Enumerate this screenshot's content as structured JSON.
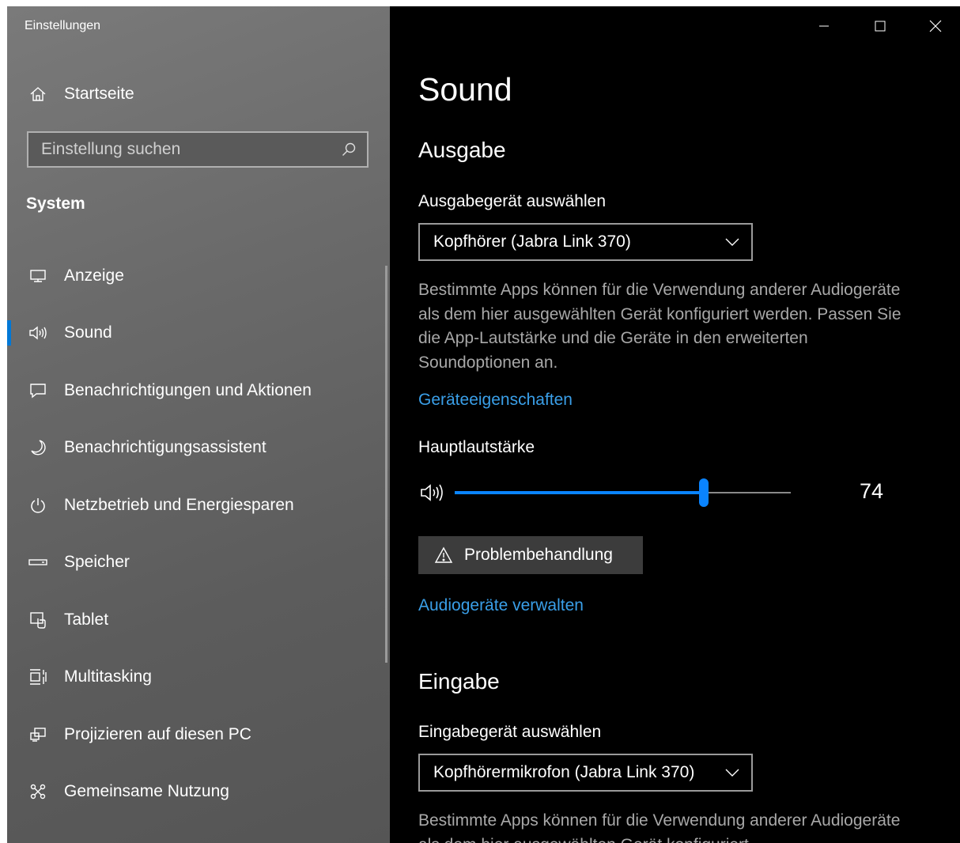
{
  "window": {
    "title": "Einstellungen"
  },
  "sidebar": {
    "home_label": "Startseite",
    "search_placeholder": "Einstellung suchen",
    "section_label": "System",
    "items": [
      {
        "label": "Anzeige",
        "icon": "monitor-icon"
      },
      {
        "label": "Sound",
        "icon": "speaker-icon",
        "active": true
      },
      {
        "label": "Benachrichtigungen und Aktionen",
        "icon": "notification-icon"
      },
      {
        "label": "Benachrichtigungsassistent",
        "icon": "moon-icon"
      },
      {
        "label": "Netzbetrieb und Energiesparen",
        "icon": "power-icon"
      },
      {
        "label": "Speicher",
        "icon": "storage-icon"
      },
      {
        "label": "Tablet",
        "icon": "tablet-icon"
      },
      {
        "label": "Multitasking",
        "icon": "multitasking-icon"
      },
      {
        "label": "Projizieren auf diesen PC",
        "icon": "project-icon"
      },
      {
        "label": "Gemeinsame Nutzung",
        "icon": "shared-icon"
      }
    ]
  },
  "content": {
    "page_title": "Sound",
    "output": {
      "heading": "Ausgabe",
      "device_label": "Ausgabegerät auswählen",
      "device_value": "Kopfhörer (Jabra Link 370)",
      "description": "Bestimmte Apps können für die Verwendung anderer Audiogeräte als dem hier ausgewählten Gerät konfiguriert werden. Passen Sie die App-Lautstärke und die Geräte in den erweiterten Soundoptionen an.",
      "properties_link": "Geräteeigenschaften",
      "volume_label": "Hauptlautstärke",
      "volume_value": "74",
      "volume_fraction": 0.74,
      "troubleshoot_label": "Problembehandlung",
      "manage_link": "Audiogeräte verwalten"
    },
    "input": {
      "heading": "Eingabe",
      "device_label": "Eingabegerät auswählen",
      "device_value": "Kopfhörermikrofon (Jabra Link 370)",
      "description": "Bestimmte Apps können für die Verwendung anderer Audiogeräte als dem hier ausgewählten Gerät konfiguriert"
    }
  },
  "colors": {
    "accent": "#0078d7",
    "link": "#3a9fe8",
    "content_background": "#000000"
  }
}
